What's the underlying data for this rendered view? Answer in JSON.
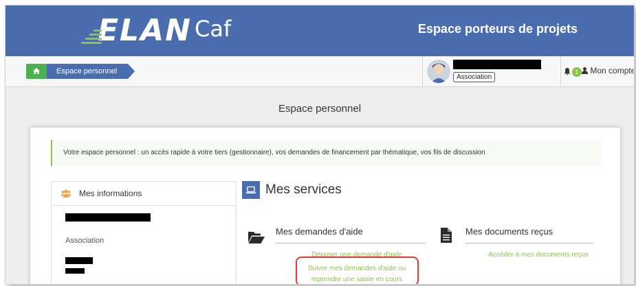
{
  "header": {
    "logo_main": "ELAN",
    "logo_sub": "Caf",
    "portal_title": "Espace porteurs de projets"
  },
  "breadcrumb": {
    "home_icon": "home-icon",
    "current": "Espace personnel"
  },
  "user": {
    "badge": "Association",
    "notification_count": "1",
    "account_label": "Mon compte"
  },
  "page": {
    "title": "Espace personnel",
    "intro": "Votre espace personnel : un accès rapide à votre tiers (gestionnaire), vos demandes de financement par thématique, vos fils de discussion"
  },
  "info_panel": {
    "title": "Mes informations",
    "type": "Association"
  },
  "services": {
    "title": "Mes services",
    "aid": {
      "title": "Mes demandes d'aide",
      "link_submit": "Déposer une demande d'aide",
      "link_follow_1": "Suivre mes demandes d'aide ou",
      "link_follow_2": "reprendre une saisie en cours"
    },
    "docs": {
      "title": "Mes documents reçus",
      "link_access": "Accéder à mes documents reçus"
    }
  },
  "colors": {
    "brand_blue": "#4a6db0",
    "accent_green": "#8bc34a",
    "highlight_red": "#e53935"
  }
}
